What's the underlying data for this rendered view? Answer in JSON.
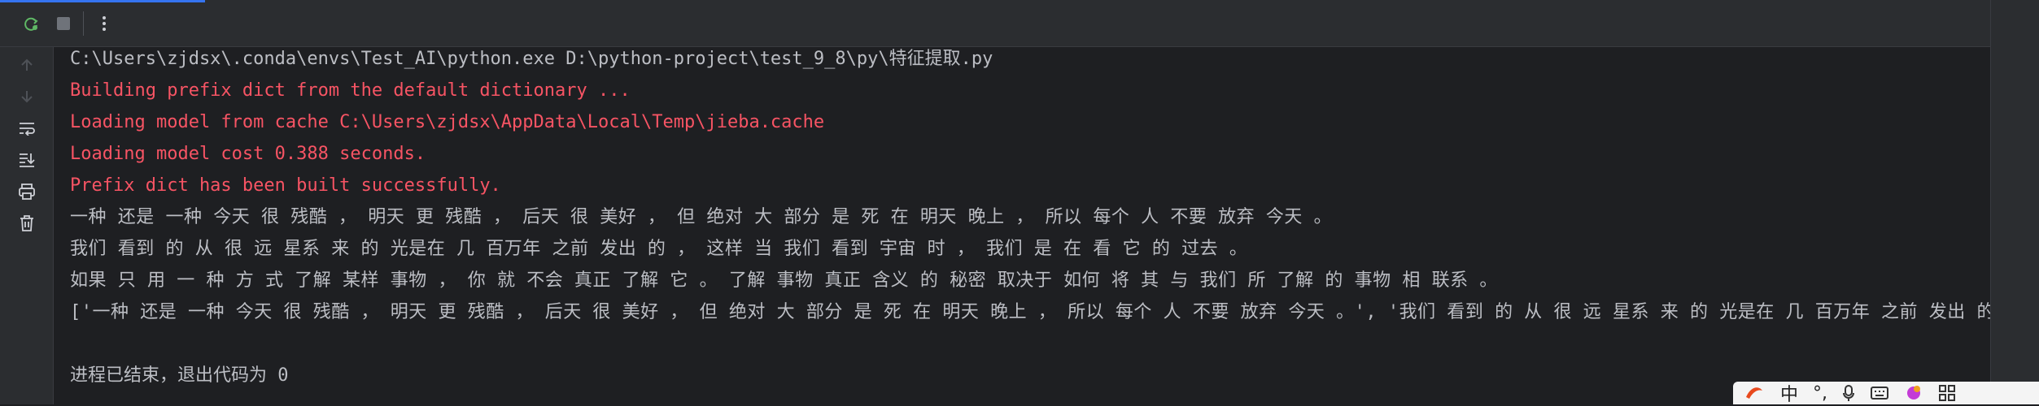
{
  "toolbar": {
    "rerun_icon": "rerun-icon",
    "stop_icon": "stop-icon",
    "more_icon": "more-options-icon"
  },
  "gutter": {
    "icons": [
      "up-arrow-icon",
      "down-arrow-icon",
      "soft-wrap-icon",
      "scroll-to-end-icon",
      "print-icon",
      "trash-icon"
    ]
  },
  "console": {
    "lines": [
      {
        "text": "C:\\Users\\zjdsx\\.conda\\envs\\Test_AI\\python.exe D:\\python-project\\test_9_8\\py\\特征提取.py",
        "kind": "normal"
      },
      {
        "text": "Building prefix dict from the default dictionary ...",
        "kind": "err"
      },
      {
        "text": "Loading model from cache C:\\Users\\zjdsx\\AppData\\Local\\Temp\\jieba.cache",
        "kind": "err"
      },
      {
        "text": "Loading model cost 0.388 seconds.",
        "kind": "err"
      },
      {
        "text": "Prefix dict has been built successfully.",
        "kind": "err"
      },
      {
        "text": "一种 还是 一种 今天 很 残酷 ， 明天 更 残酷 ， 后天 很 美好 ， 但 绝对 大 部分 是 死 在 明天 晚上 ， 所以 每个 人 不要 放弃 今天 。",
        "kind": "seg"
      },
      {
        "text": "我们 看到 的 从 很 远 星系 来 的 光是在 几 百万年 之前 发出 的 ， 这样 当 我们 看到 宇宙 时 ， 我们 是 在 看 它 的 过去 。",
        "kind": "seg"
      },
      {
        "text": "如果 只 用 一 种 方 式 了解 某样 事物 ， 你 就 不会 真正 了解 它 。 了解 事物 真正 含义 的 秘密 取决于 如何 将 其 与 我们 所 了解 的 事物 相 联系 。",
        "kind": "seg"
      },
      {
        "text": "['一种 还是 一种 今天 很 残酷 ， 明天 更 残酷 ， 后天 很 美好 ， 但 绝对 大 部分 是 死 在 明天 晚上 ， 所以 每个 人 不要 放弃 今天 。', '我们 看到 的 从 很 远 星系 来 的 光是在 几 百万年 之前 发出 的 ，",
        "kind": "seg"
      },
      {
        "text": "",
        "kind": "normal"
      },
      {
        "text": "进程已结束，退出代码为 0",
        "kind": "normal"
      }
    ]
  },
  "ime_bar": {
    "lang": "中",
    "punct": "°,"
  }
}
